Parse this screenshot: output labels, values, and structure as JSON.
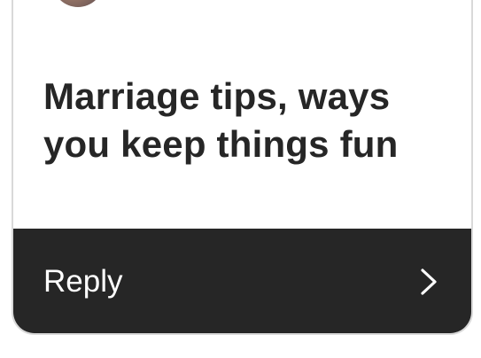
{
  "card": {
    "prompt": "Marriage tips, ways you keep things fun",
    "reply_label": "Reply",
    "colors": {
      "background": "#ffffff",
      "text": "#262626",
      "reply_bar": "#262626",
      "reply_text": "#ffffff",
      "border": "#d9d9d9"
    },
    "icons": {
      "avatar": "profile-avatar",
      "reply_arrow": "chevron-right-icon"
    }
  }
}
